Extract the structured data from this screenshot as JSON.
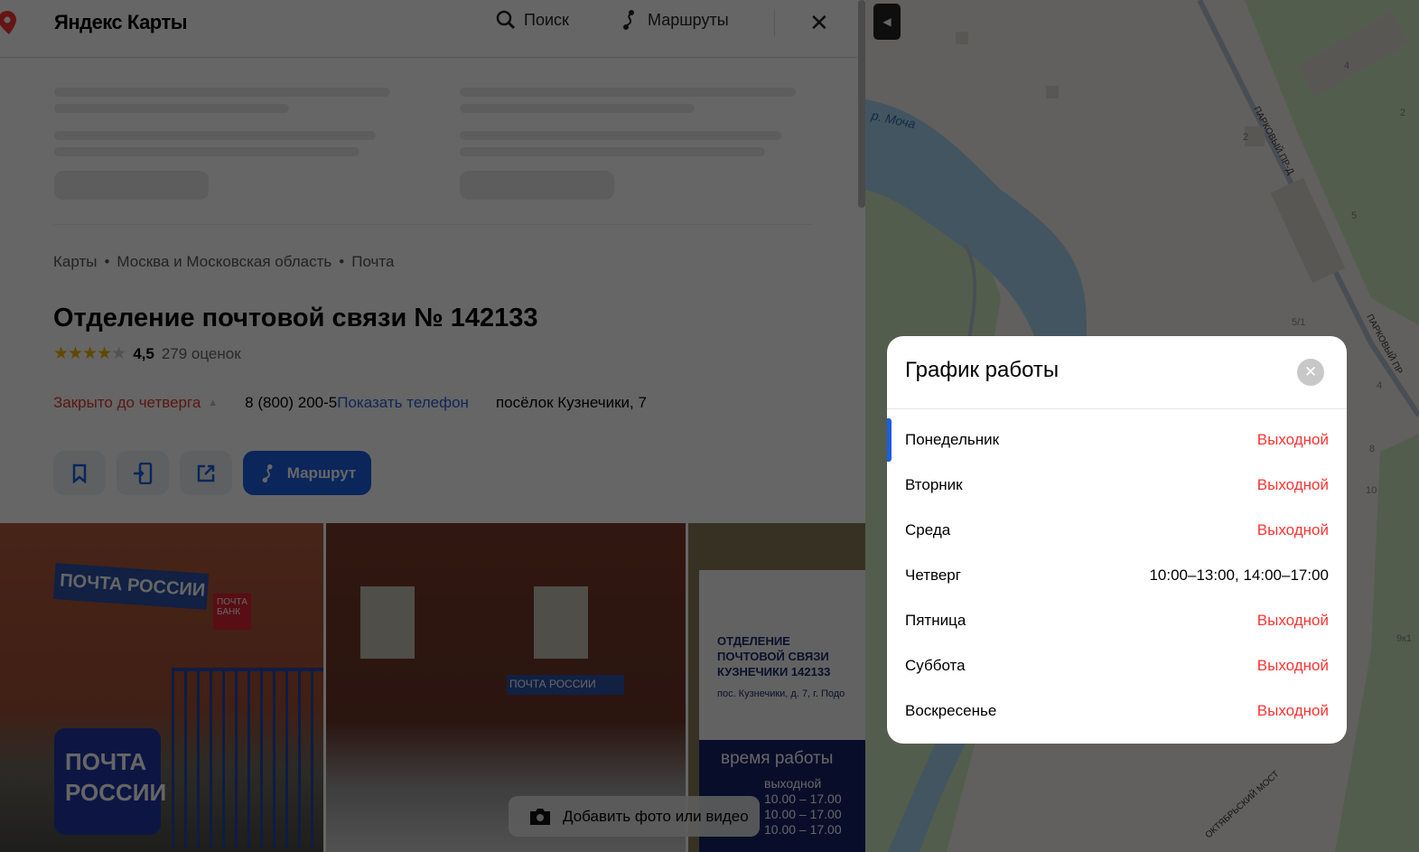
{
  "header": {
    "logo": "Яндекс Карты",
    "search": "Поиск",
    "routes": "Маршруты",
    "close": "✕"
  },
  "breadcrumbs": [
    "Карты",
    "Москва и Московская область",
    "Почта"
  ],
  "place": {
    "title": "Отделение почтовой связи № 142133",
    "rating": "4,5",
    "rating_value": 4.5,
    "reviews": "279 оценок",
    "status": "Закрыто до четверга",
    "phone": "8 (800) 200-5",
    "show_phone": "Показать телефон",
    "address": "посёлок Кузнечики, 7",
    "route_button": "Маршрут"
  },
  "photos": {
    "add_label": "Добавить фото или видео",
    "lettering": {
      "sign1": "ПОЧТА РОССИИ",
      "bank": "ПОЧТА БАНК",
      "sign_office": "ОТДЕЛЕНИЕ ПОЧТОВОЙ СВЯЗИ КУЗНЕЧИКИ 142133",
      "sign_addr": "пос. Кузнечики, д. 7, г. Подо",
      "hours_title": "время работы",
      "hours": [
        "выходной",
        "10.00 – 17.00",
        "10.00 – 17.00",
        "10.00 – 17.00"
      ]
    }
  },
  "map": {
    "labels": {
      "river": "р. Моча",
      "street1": "ПАРКОВЫЙ ПР-Д",
      "street2": "ПАРКОВЫЙ ПР",
      "bridge": "ОКТЯБРЬСКИЙ МОСТ",
      "h4": "4",
      "h2a": "2",
      "h2b": "2",
      "h5": "5",
      "h51": "5/1",
      "h8": "8",
      "h10": "10",
      "h4b": "4",
      "h9": "9к1"
    },
    "collapse": "◀"
  },
  "schedule": {
    "title": "График работы",
    "close": "✕",
    "days": [
      {
        "day": "Понедельник",
        "hours": "Выходной",
        "off": true
      },
      {
        "day": "Вторник",
        "hours": "Выходной",
        "off": true
      },
      {
        "day": "Среда",
        "hours": "Выходной",
        "off": true
      },
      {
        "day": "Четверг",
        "hours": "10:00–13:00, 14:00–17:00",
        "off": false
      },
      {
        "day": "Пятница",
        "hours": "Выходной",
        "off": true
      },
      {
        "day": "Суббота",
        "hours": "Выходной",
        "off": true
      },
      {
        "day": "Воскресенье",
        "hours": "Выходной",
        "off": true
      }
    ]
  }
}
